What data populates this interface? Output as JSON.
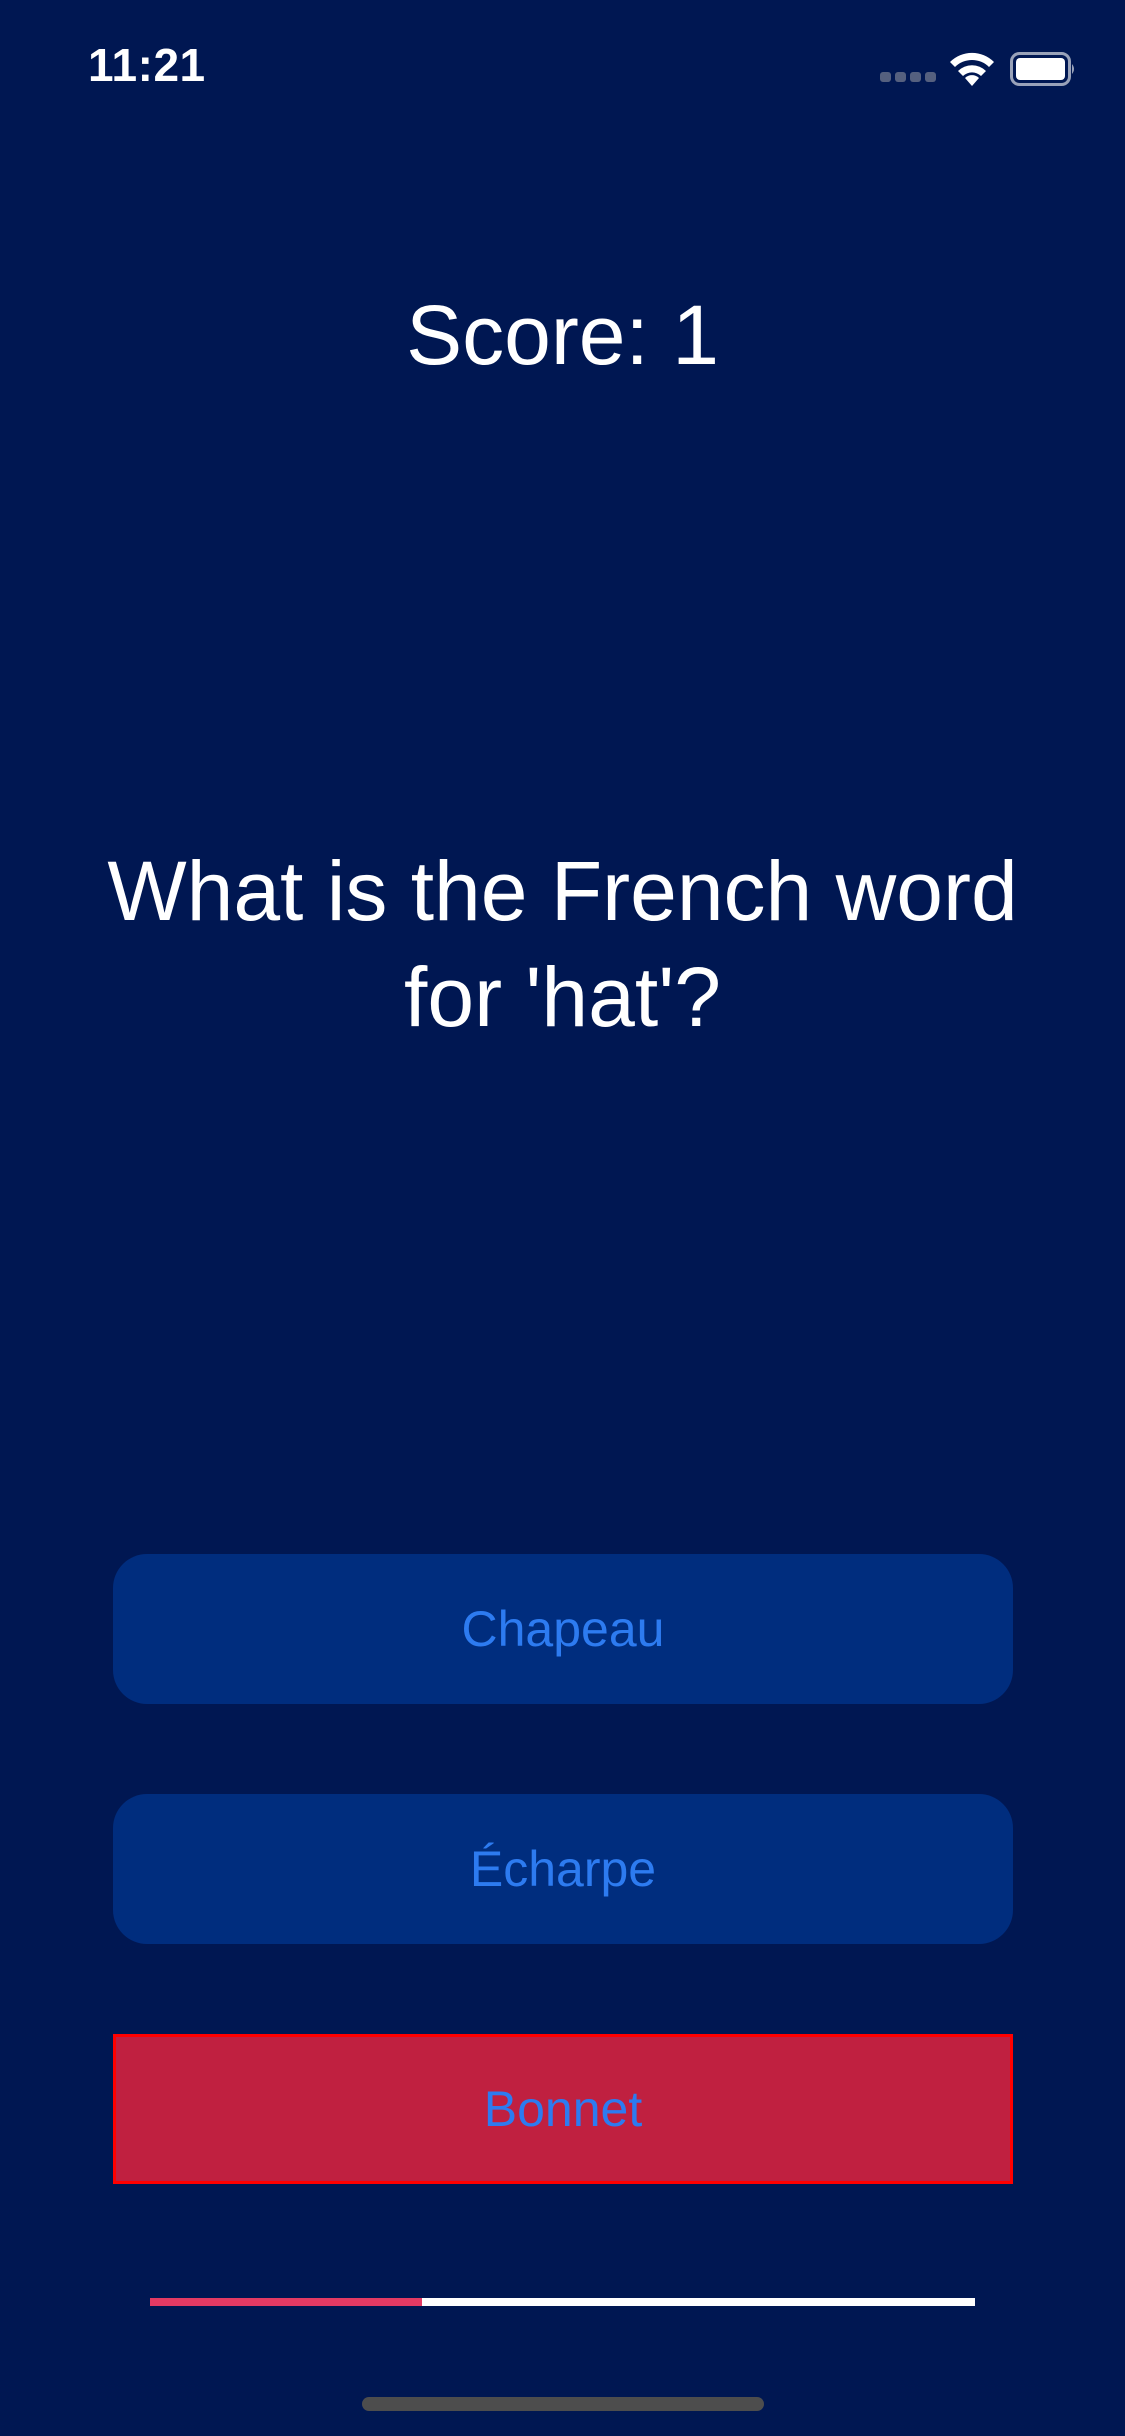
{
  "status_bar": {
    "time": "11:21",
    "icons": [
      "signal-icon",
      "wifi-icon",
      "battery-icon"
    ]
  },
  "quiz": {
    "score": "Score: 1",
    "question": "What is the French word for 'hat'?",
    "answers": [
      {
        "label": "Chapeau",
        "state": "default"
      },
      {
        "label": "Écharpe",
        "state": "default"
      },
      {
        "label": "Bonnet",
        "state": "selected-incorrect"
      }
    ],
    "progress": 0.33
  },
  "colors": {
    "background": "#001752",
    "button": "#002d7e",
    "button_text": "#2d7bf0",
    "incorrect": "#c02040",
    "progress_fill": "#e33a63",
    "progress_track": "#ffffff"
  }
}
